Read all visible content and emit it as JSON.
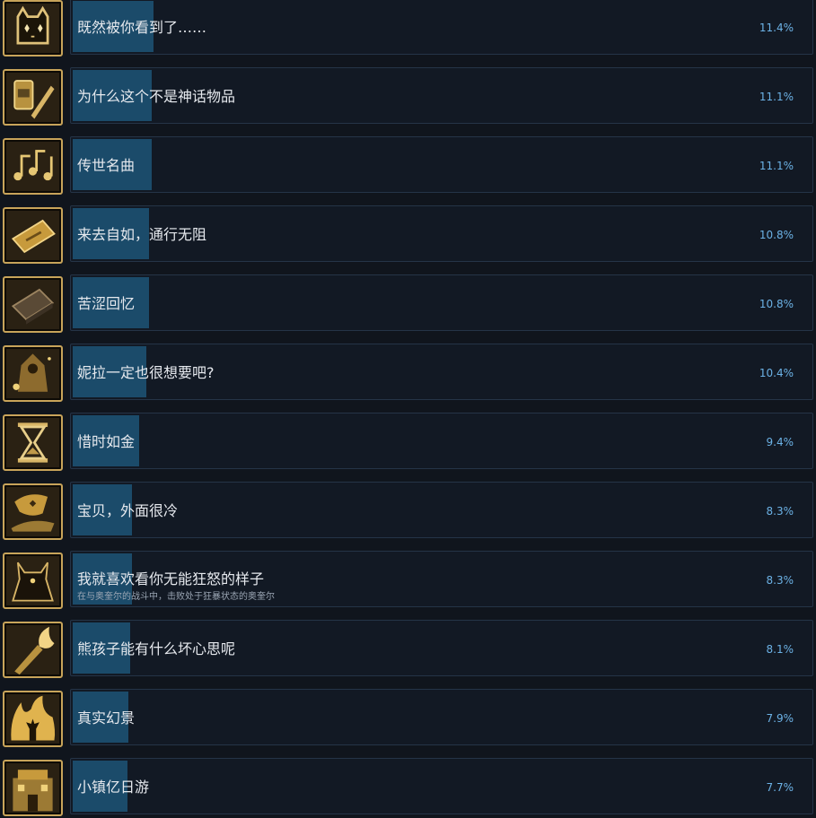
{
  "achievements": [
    {
      "title": "既然被你看到了……",
      "description": "",
      "percent_text": "11.4%",
      "percent": 11.4,
      "icon": "cat-sparkle-icon"
    },
    {
      "title": "为什么这个不是神话物品",
      "description": "",
      "percent_text": "11.1%",
      "percent": 11.1,
      "icon": "jar-sword-icon"
    },
    {
      "title": "传世名曲",
      "description": "",
      "percent_text": "11.1%",
      "percent": 11.1,
      "icon": "music-notes-icon"
    },
    {
      "title": "来去自如，通行无阻",
      "description": "",
      "percent_text": "10.8%",
      "percent": 10.8,
      "icon": "ticket-icon"
    },
    {
      "title": "苦涩回忆",
      "description": "",
      "percent_text": "10.8%",
      "percent": 10.8,
      "icon": "book-icon"
    },
    {
      "title": "妮拉一定也很想要吧?",
      "description": "",
      "percent_text": "10.4%",
      "percent": 10.4,
      "icon": "hooded-figure-icon"
    },
    {
      "title": "惜时如金",
      "description": "",
      "percent_text": "9.4%",
      "percent": 9.4,
      "icon": "hourglass-icon"
    },
    {
      "title": "宝贝，外面很冷",
      "description": "",
      "percent_text": "8.3%",
      "percent": 8.3,
      "icon": "cloak-icon"
    },
    {
      "title": "我就喜欢看你无能狂怒的样子",
      "description": "在与奥奎尔的战斗中，击败处于狂暴状态的奥奎尔",
      "percent_text": "8.3%",
      "percent": 8.3,
      "icon": "demon-silhouette-icon"
    },
    {
      "title": "熊孩子能有什么坏心思呢",
      "description": "",
      "percent_text": "8.1%",
      "percent": 8.1,
      "icon": "torch-icon"
    },
    {
      "title": "真实幻景",
      "description": "",
      "percent_text": "7.9%",
      "percent": 7.9,
      "icon": "fire-figure-icon"
    },
    {
      "title": "小镇亿日游",
      "description": "",
      "percent_text": "7.7%",
      "percent": 7.7,
      "icon": "building-icon"
    }
  ],
  "colors": {
    "background": "#10151d",
    "panel": "#121924",
    "bar_fill": "#1b4b6a",
    "percent_text": "#6cb2e6",
    "icon_gold": "#c8a45a"
  }
}
